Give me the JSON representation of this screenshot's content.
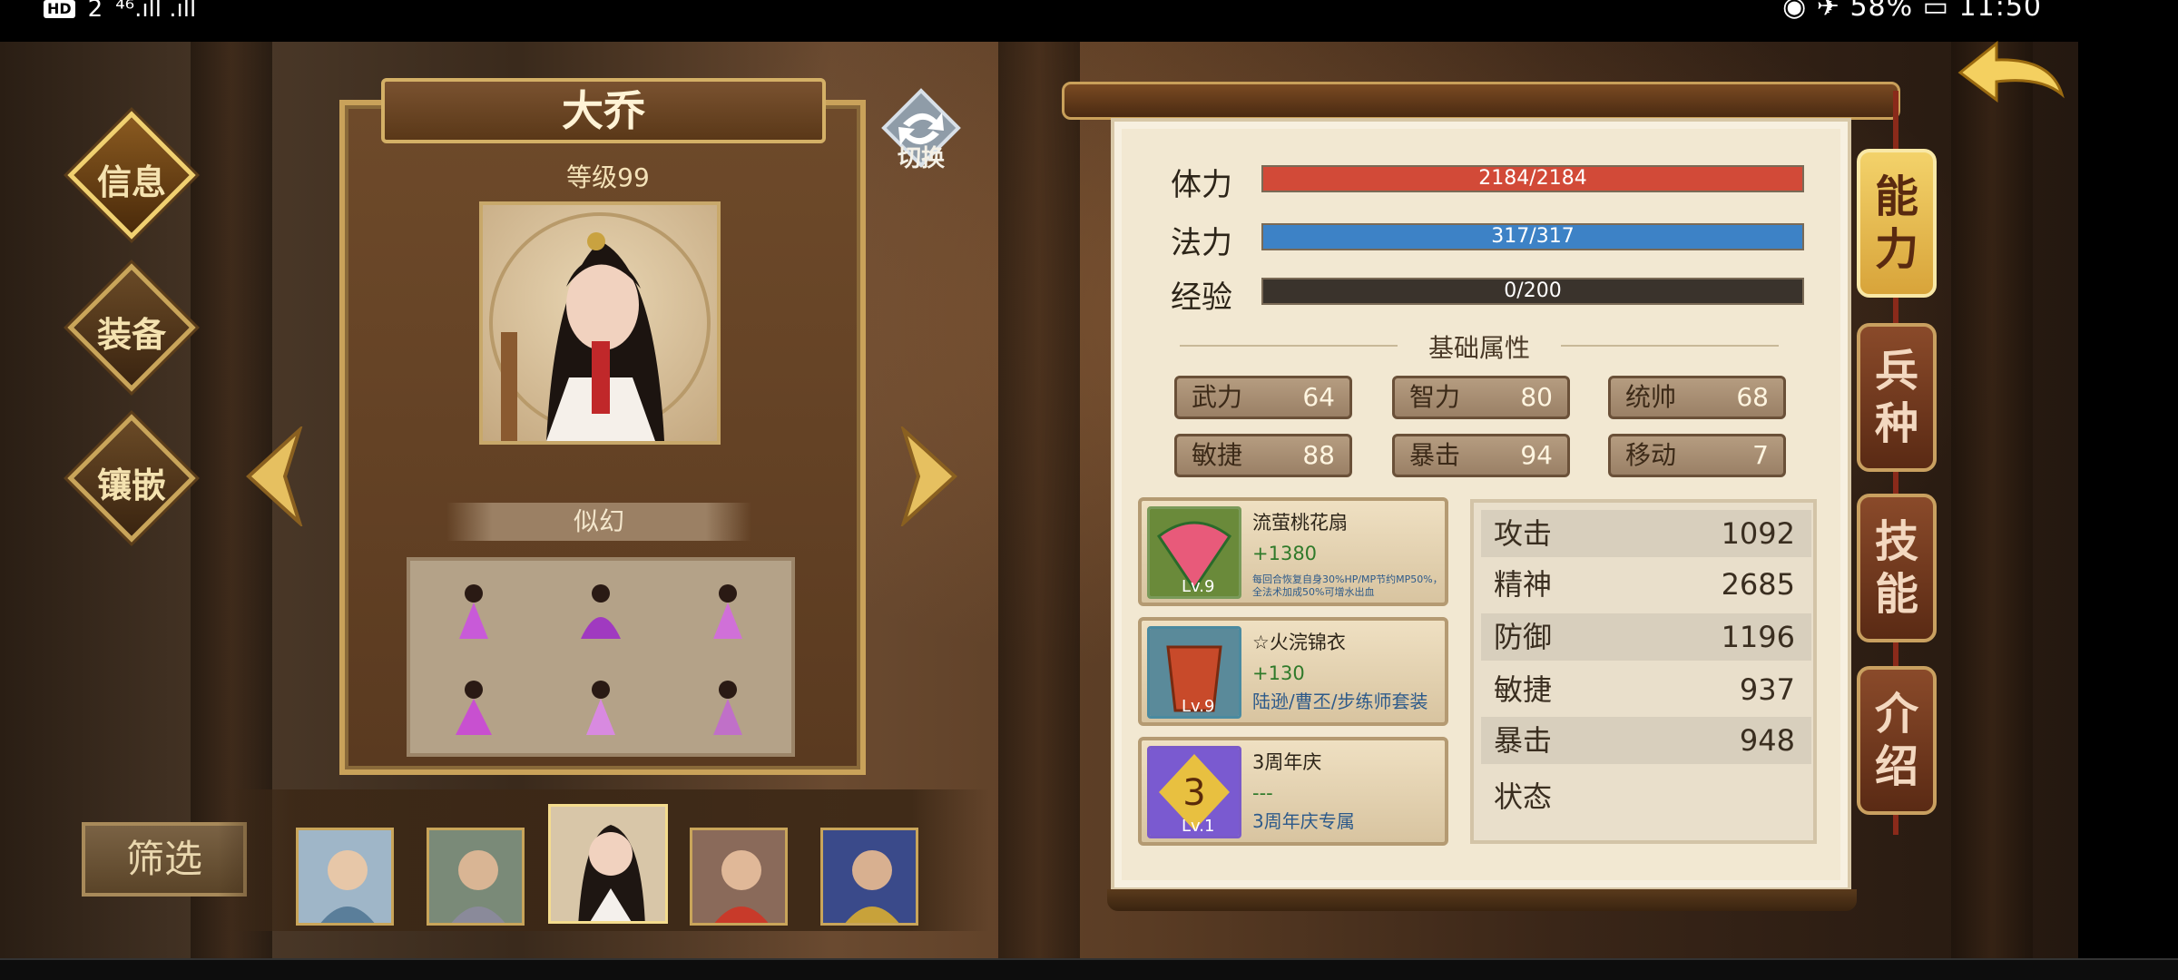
{
  "statusbar": {
    "hd": "HD",
    "sim": "2",
    "signal": "⁴⁶.ıll  .ıll",
    "right": "◉ ✈ 58% ▭ 11:50"
  },
  "nav": {
    "info": "信息",
    "equip": "装备",
    "inlay": "镶嵌"
  },
  "hero": {
    "name": "大乔",
    "level": "等级99",
    "skin_label": "似幻",
    "switch_label": "切换"
  },
  "filter_label": "筛选",
  "bars": [
    {
      "label": "体力",
      "text": "2184/2184",
      "fill": 1.0,
      "color": "#d24a38"
    },
    {
      "label": "法力",
      "text": "317/317",
      "fill": 1.0,
      "color": "#3d82c6"
    },
    {
      "label": "经验",
      "text": "0/200",
      "fill": 0.0,
      "color": "#5a7a3a"
    }
  ],
  "section_title": "基础属性",
  "attrs": [
    {
      "k": "武力",
      "v": "64"
    },
    {
      "k": "智力",
      "v": "80"
    },
    {
      "k": "统帅",
      "v": "68"
    },
    {
      "k": "敏捷",
      "v": "88"
    },
    {
      "k": "暴击",
      "v": "94"
    },
    {
      "k": "移动",
      "v": "7"
    }
  ],
  "equips": [
    {
      "name": "流萤桃花扇",
      "bonus": "+1380",
      "desc": "每回合恢复自身30%HP/MP节约MP50%，全法术加成50%可增水出血",
      "lv": "Lv.9"
    },
    {
      "name": "☆火浣锦衣",
      "bonus": "+130",
      "desc": "陆逊/曹丕/步练师套装",
      "lv": "Lv.9"
    },
    {
      "name": "3周年庆",
      "bonus": "---",
      "desc": "3周年庆专属",
      "lv": "Lv.1"
    }
  ],
  "derived": [
    {
      "k": "攻击",
      "v": "1092"
    },
    {
      "k": "精神",
      "v": "2685"
    },
    {
      "k": "防御",
      "v": "1196"
    },
    {
      "k": "敏捷",
      "v": "937"
    },
    {
      "k": "暴击",
      "v": "948"
    },
    {
      "k": "状态",
      "v": ""
    }
  ],
  "tabs": [
    {
      "label": "能力"
    },
    {
      "label": "兵种"
    },
    {
      "label": "技能"
    },
    {
      "label": "介绍"
    }
  ]
}
